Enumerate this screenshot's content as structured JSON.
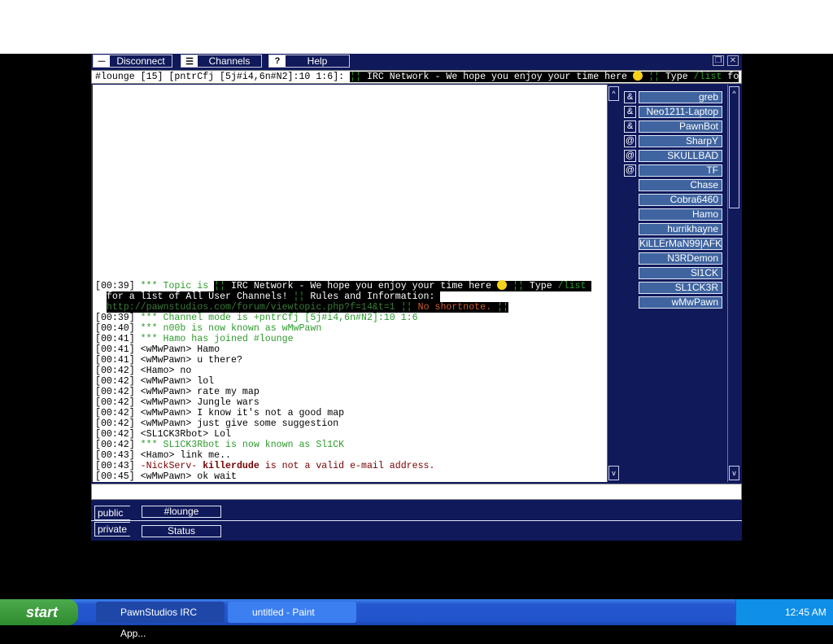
{
  "toolbar": {
    "disconnect": "Disconnect",
    "channels": "Channels",
    "help": "Help"
  },
  "topic_bar": {
    "prefix": "#lounge [15] [pntrCfj [5j#i4,6n#N2]:10 1:6]: ",
    "sep": "¦¦",
    "text": " IRC Network - We hope you enjoy your time here ",
    "type": " Type ",
    "cmd": "/list",
    "rest": " fo"
  },
  "chat": {
    "topic": {
      "time": "[00:39] ",
      "label": "*** Topic is ",
      "sep": "¦¦",
      "t1": " IRC Network - We hope you enjoy your time here ",
      "t2": " Type ",
      "cmd": "/list",
      "l2a": "for a list of All User Channels! ",
      "l2b": " Rules and Information: ",
      "url": "http://pawnstudios.com/forum/viewtopic.php?f=14&t=1",
      "nosn": "No shortnote."
    },
    "lines": [
      {
        "time": "[00:39]",
        "text": "*** Channel mode is +pntrCfj [5j#i4,6n#N2]:10 1:6",
        "style": "g"
      },
      {
        "time": "[00:40]",
        "text": "*** n00b is now known as wMwPawn",
        "style": "g"
      },
      {
        "time": "[00:41]",
        "text": "*** Hamo has joined #lounge",
        "style": "g"
      },
      {
        "time": "[00:41]",
        "text": "<wMwPawn> Hamo",
        "style": "k"
      },
      {
        "time": "[00:41]",
        "text": "<wMwPawn> u there?",
        "style": "k"
      },
      {
        "time": "[00:42]",
        "text": "<Hamo> no",
        "style": "k"
      },
      {
        "time": "[00:42]",
        "text": "<wMwPawn> lol",
        "style": "k"
      },
      {
        "time": "[00:42]",
        "text": "<wMwPawn> rate my map",
        "style": "k"
      },
      {
        "time": "[00:42]",
        "text": "<wMwPawn> Jungle wars",
        "style": "k"
      },
      {
        "time": "[00:42]",
        "text": "<wMwPawn> I know it's not a good map",
        "style": "k"
      },
      {
        "time": "[00:42]",
        "text": "<wMwPawn> just give some suggestion",
        "style": "k"
      },
      {
        "time": "[00:42]",
        "text": "<SL1CK3Rbot> Lol",
        "style": "k"
      },
      {
        "time": "[00:42]",
        "text": "*** SL1CK3Rbot is now known as Sl1CK",
        "style": "g"
      },
      {
        "time": "[00:43]",
        "text": "<Hamo> link me..",
        "style": "k"
      }
    ],
    "notice": {
      "time": "[00:43]",
      "a": "-NickServ- ",
      "nick": "killerdude",
      "b": " is not a valid e-mail address."
    },
    "last": {
      "time": "[00:45]",
      "text": "<wMwPawn> ok wait"
    }
  },
  "nicklist": [
    {
      "prefix": "&",
      "nick": "greb"
    },
    {
      "prefix": "&",
      "nick": "Neo1211-Laptop"
    },
    {
      "prefix": "&",
      "nick": "PawnBot"
    },
    {
      "prefix": "@",
      "nick": "SharpY"
    },
    {
      "prefix": "@",
      "nick": "SKULLBAD"
    },
    {
      "prefix": "@",
      "nick": "TF"
    },
    {
      "prefix": "",
      "nick": "Chase"
    },
    {
      "prefix": "",
      "nick": "Cobra6460"
    },
    {
      "prefix": "",
      "nick": "Hamo"
    },
    {
      "prefix": "",
      "nick": "hurrikhayne"
    },
    {
      "prefix": "",
      "nick": "KiLLErMaN99|AFK"
    },
    {
      "prefix": "",
      "nick": "N3RDemon"
    },
    {
      "prefix": "",
      "nick": "Sl1CK"
    },
    {
      "prefix": "",
      "nick": "SL1CK3R"
    },
    {
      "prefix": "",
      "nick": "wMwPawn"
    }
  ],
  "tabs": {
    "public_label": "public",
    "public_tab": "#lounge",
    "private_label": "private",
    "private_tab": "Status"
  },
  "taskbar": {
    "start": "start",
    "tasks": [
      "PawnStudios IRC App...",
      "untitled - Paint"
    ],
    "clock": "12:45 AM"
  },
  "colors": {
    "app_bg": "#10195a",
    "nick_bg": "#3f64a0",
    "system_msg": "#2e9a2e",
    "notice": "#700000"
  }
}
